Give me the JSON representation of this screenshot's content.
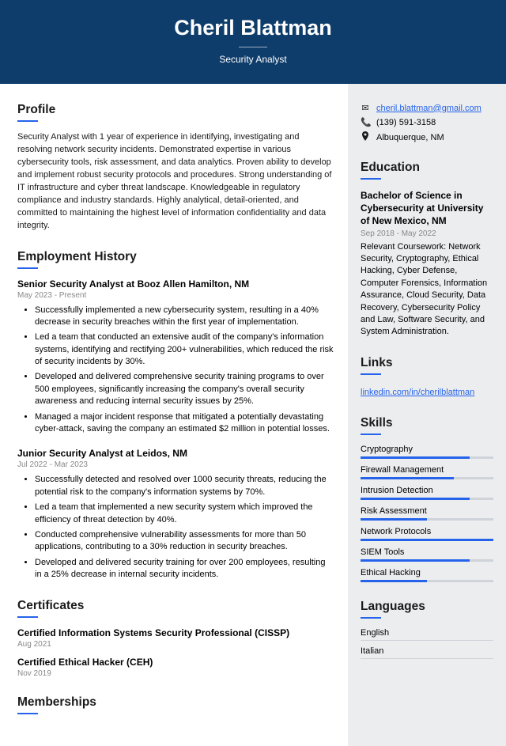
{
  "header": {
    "name": "Cheril Blattman",
    "subtitle": "Security Analyst"
  },
  "profile": {
    "heading": "Profile",
    "text": "Security Analyst with 1 year of experience in identifying, investigating and resolving network security incidents. Demonstrated expertise in various cybersecurity tools, risk assessment, and data analytics. Proven ability to develop and implement robust security protocols and procedures. Strong understanding of IT infrastructure and cyber threat landscape. Knowledgeable in regulatory compliance and industry standards. Highly analytical, detail-oriented, and committed to maintaining the highest level of information confidentiality and data integrity."
  },
  "employment": {
    "heading": "Employment History",
    "jobs": [
      {
        "title": "Senior Security Analyst at Booz Allen Hamilton, NM",
        "dates": "May 2023 - Present",
        "bullets": [
          "Successfully implemented a new cybersecurity system, resulting in a 40% decrease in security breaches within the first year of implementation.",
          "Led a team that conducted an extensive audit of the company's information systems, identifying and rectifying 200+ vulnerabilities, which reduced the risk of security incidents by 30%.",
          "Developed and delivered comprehensive security training programs to over 500 employees, significantly increasing the company's overall security awareness and reducing internal security issues by 25%.",
          "Managed a major incident response that mitigated a potentially devastating cyber-attack, saving the company an estimated $2 million in potential losses."
        ]
      },
      {
        "title": "Junior Security Analyst at Leidos, NM",
        "dates": "Jul 2022 - Mar 2023",
        "bullets": [
          "Successfully detected and resolved over 1000 security threats, reducing the potential risk to the company's information systems by 70%.",
          "Led a team that implemented a new security system which improved the efficiency of threat detection by 40%.",
          "Conducted comprehensive vulnerability assessments for more than 50 applications, contributing to a 30% reduction in security breaches.",
          "Developed and delivered security training for over 200 employees, resulting in a 25% decrease in internal security incidents."
        ]
      }
    ]
  },
  "certificates": {
    "heading": "Certificates",
    "items": [
      {
        "name": "Certified Information Systems Security Professional (CISSP)",
        "date": "Aug 2021"
      },
      {
        "name": "Certified Ethical Hacker (CEH)",
        "date": "Nov 2019"
      }
    ]
  },
  "memberships": {
    "heading": "Memberships"
  },
  "contact": {
    "email": "cheril.blattman@gmail.com",
    "phone": "(139) 591-3158",
    "location": "Albuquerque, NM"
  },
  "education": {
    "heading": "Education",
    "degree": "Bachelor of Science in Cybersecurity at University of New Mexico, NM",
    "dates": "Sep 2018 - May 2022",
    "text": "Relevant Coursework: Network Security, Cryptography, Ethical Hacking, Cyber Defense, Computer Forensics, Information Assurance, Cloud Security, Data Recovery, Cybersecurity Policy and Law, Software Security, and System Administration."
  },
  "links": {
    "heading": "Links",
    "items": [
      "linkedin.com/in/cherilblattman"
    ]
  },
  "skills": {
    "heading": "Skills",
    "items": [
      {
        "name": "Cryptography",
        "level": 82
      },
      {
        "name": "Firewall Management",
        "level": 70
      },
      {
        "name": "Intrusion Detection",
        "level": 82
      },
      {
        "name": "Risk Assessment",
        "level": 50
      },
      {
        "name": "Network Protocols",
        "level": 100
      },
      {
        "name": "SIEM Tools",
        "level": 82
      },
      {
        "name": "Ethical Hacking",
        "level": 50
      }
    ]
  },
  "languages": {
    "heading": "Languages",
    "items": [
      "English",
      "Italian"
    ]
  }
}
